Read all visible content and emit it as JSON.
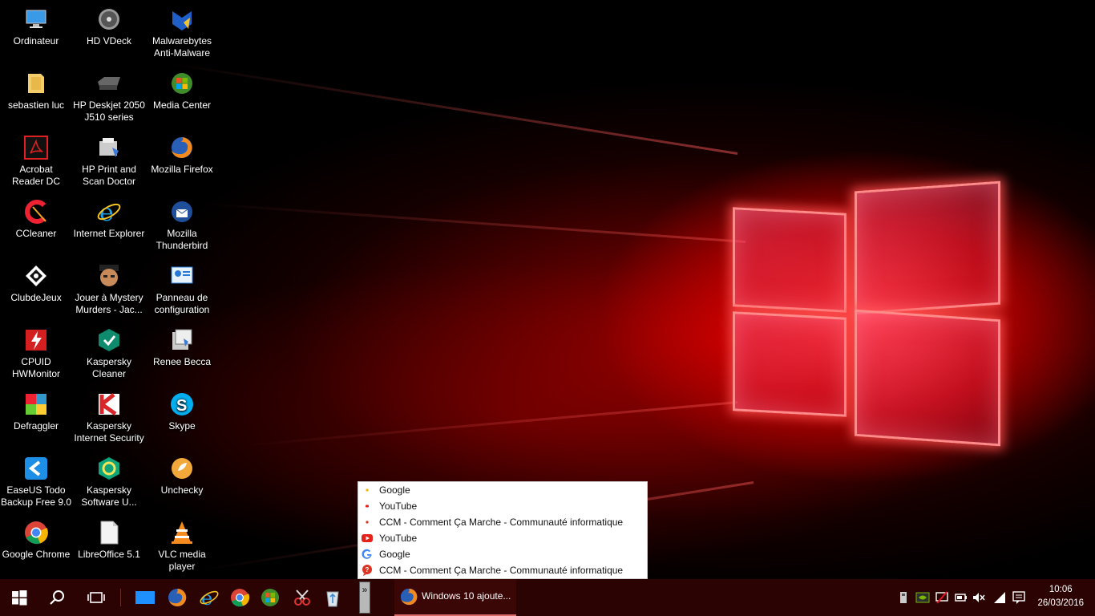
{
  "desktop": {
    "icons": [
      {
        "label": "Ordinateur",
        "icon": "computer-icon"
      },
      {
        "label": "HD VDeck",
        "icon": "hd-vdeck-icon"
      },
      {
        "label": "Malwarebytes\nAnti-Malware",
        "icon": "malwarebytes-icon"
      },
      {
        "label": "sebastien luc",
        "icon": "user-folder-icon"
      },
      {
        "label": "HP Deskjet 2050\nJ510 series",
        "icon": "printer-icon"
      },
      {
        "label": "Media Center",
        "icon": "media-center-icon"
      },
      {
        "label": "Acrobat\nReader DC",
        "icon": "acrobat-icon"
      },
      {
        "label": "HP Print and\nScan Doctor",
        "icon": "hp-scan-doctor-icon"
      },
      {
        "label": "Mozilla Firefox",
        "icon": "firefox-icon"
      },
      {
        "label": "CCleaner",
        "icon": "ccleaner-icon"
      },
      {
        "label": "Internet Explorer",
        "icon": "internet-explorer-icon"
      },
      {
        "label": "Mozilla\nThunderbird",
        "icon": "thunderbird-icon"
      },
      {
        "label": "ClubdeJeux",
        "icon": "clubdejeux-icon"
      },
      {
        "label": "Jouer à Mystery\nMurders - Jac...",
        "icon": "mystery-murders-icon"
      },
      {
        "label": "Panneau de\nconfiguration",
        "icon": "control-panel-icon"
      },
      {
        "label": "CPUID\nHWMonitor",
        "icon": "hwmonitor-icon"
      },
      {
        "label": "Kaspersky\nCleaner",
        "icon": "kaspersky-cleaner-icon"
      },
      {
        "label": "Renee Becca",
        "icon": "renee-becca-icon"
      },
      {
        "label": "Defraggler",
        "icon": "defraggler-icon"
      },
      {
        "label": "Kaspersky\nInternet Security",
        "icon": "kaspersky-internet-security-icon"
      },
      {
        "label": "Skype",
        "icon": "skype-icon"
      },
      {
        "label": "EaseUS Todo\nBackup Free 9.0",
        "icon": "easeus-icon"
      },
      {
        "label": "Kaspersky\nSoftware U...",
        "icon": "kaspersky-software-updater-icon"
      },
      {
        "label": "Unchecky",
        "icon": "unchecky-icon"
      },
      {
        "label": "Google Chrome",
        "icon": "chrome-icon"
      },
      {
        "label": "LibreOffice 5.1",
        "icon": "libreoffice-icon"
      },
      {
        "label": "VLC media\nplayer",
        "icon": "vlc-icon"
      }
    ]
  },
  "jumplist": {
    "items": [
      {
        "label": "Google",
        "icon": "google-small-icon"
      },
      {
        "label": "YouTube",
        "icon": "youtube-small-icon"
      },
      {
        "label": "CCM - Comment Ça Marche - Communauté informatique",
        "icon": "ccm-small-icon"
      },
      {
        "label": "YouTube",
        "icon": "youtube-icon"
      },
      {
        "label": "Google",
        "icon": "google-icon"
      },
      {
        "label": "CCM - Comment Ça Marche - Communauté informatique",
        "icon": "ccm-icon"
      }
    ]
  },
  "taskbar": {
    "active_task_label": "Windows 10 ajoute...",
    "pinned": [
      "desktop-icon",
      "firefox-icon",
      "internet-explorer-icon",
      "chrome-icon",
      "media-center-icon",
      "snipping-tool-icon",
      "recycle-bin-icon"
    ],
    "clock": {
      "time": "10:06",
      "date": "26/03/2016"
    },
    "overflow_label": "»"
  },
  "colors": {
    "taskbar": "#2b0303",
    "accent": "#e81123"
  }
}
